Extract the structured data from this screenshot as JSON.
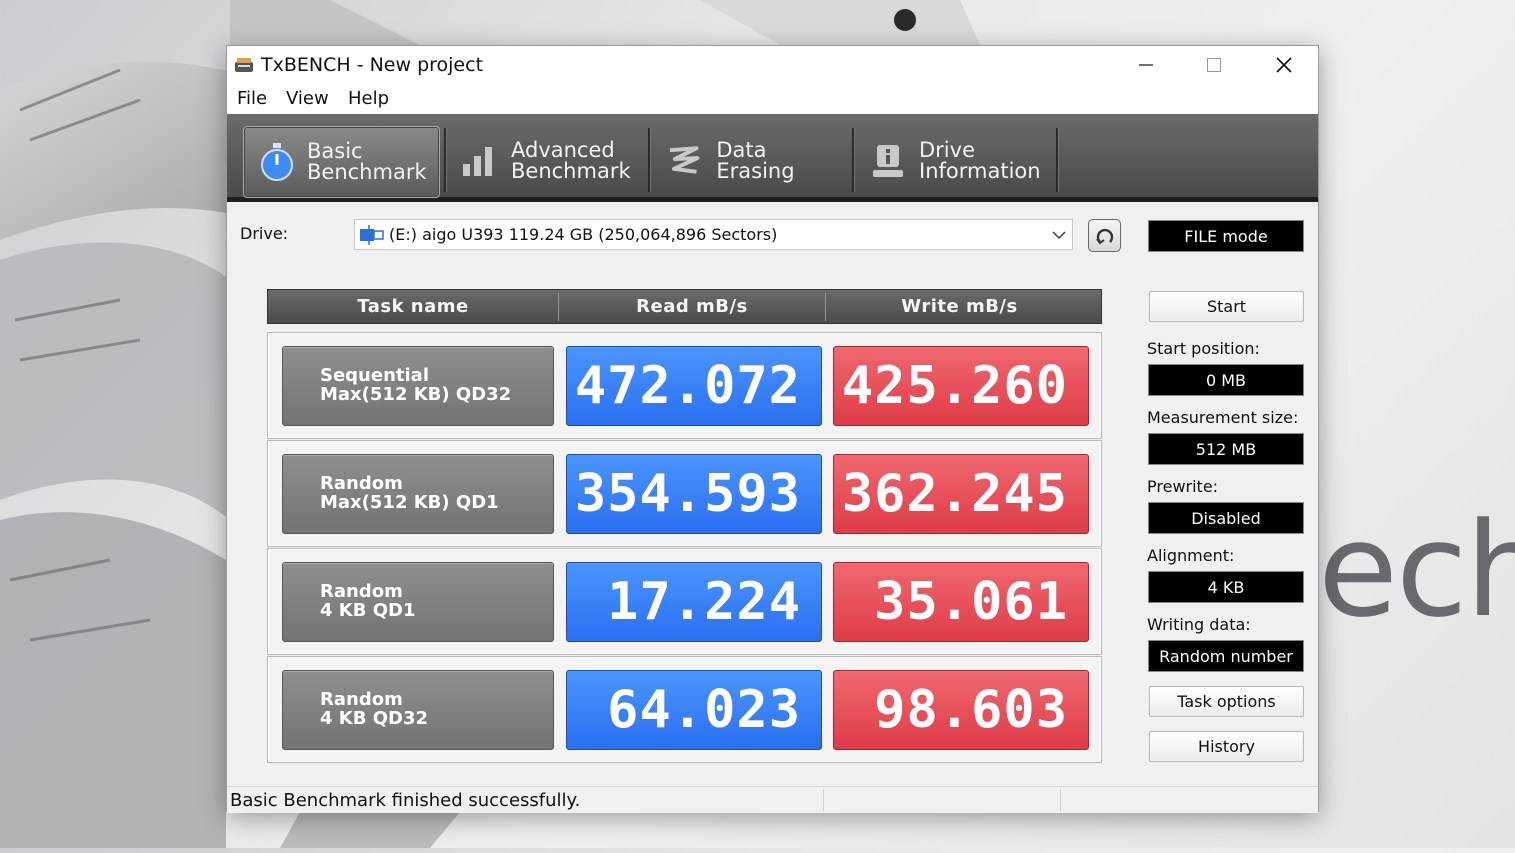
{
  "window": {
    "title": "TxBENCH - New project"
  },
  "menu": {
    "file": "File",
    "view": "View",
    "help": "Help"
  },
  "toolbar": {
    "tabs": [
      {
        "line1": "Basic",
        "line2": "Benchmark",
        "icon": "stopwatch-icon"
      },
      {
        "line1": "Advanced",
        "line2": "Benchmark",
        "icon": "bar-chart-icon"
      },
      {
        "line1": "Data Erasing",
        "line2": "",
        "icon": "eraser-icon"
      },
      {
        "line1": "Drive",
        "line2": "Information",
        "icon": "drive-info-icon"
      }
    ]
  },
  "drive": {
    "label": "Drive:",
    "selected": "(E:) aigo U393  119.24 GB (250,064,896 Sectors)",
    "mode": "FILE mode"
  },
  "table": {
    "headers": [
      "Task name",
      "Read mB/s",
      "Write mB/s"
    ],
    "rows": [
      {
        "name1": "Sequential",
        "name2": "Max(512 KB) QD32",
        "read": "472.072",
        "write": "425.260"
      },
      {
        "name1": "Random",
        "name2": "Max(512 KB) QD1",
        "read": "354.593",
        "write": "362.245"
      },
      {
        "name1": "Random",
        "name2": "4 KB QD1",
        "read": "17.224",
        "write": "35.061"
      },
      {
        "name1": "Random",
        "name2": "4 KB QD32",
        "read": "64.023",
        "write": "98.603"
      }
    ]
  },
  "side": {
    "start_button": "Start",
    "start_position_label": "Start position:",
    "start_position": "0 MB",
    "measurement_size_label": "Measurement size:",
    "measurement_size": "512 MB",
    "prewrite_label": "Prewrite:",
    "prewrite": "Disabled",
    "alignment_label": "Alignment:",
    "alignment": "4 KB",
    "writing_data_label": "Writing data:",
    "writing_data": "Random number",
    "task_options_button": "Task options",
    "history_button": "History"
  },
  "status": {
    "text": "Basic Benchmark finished successfully."
  },
  "wallpaper": {
    "word": "ech"
  },
  "colors": {
    "read": "#2f74f2",
    "write": "#e0434f",
    "toolbar": "#555555"
  }
}
